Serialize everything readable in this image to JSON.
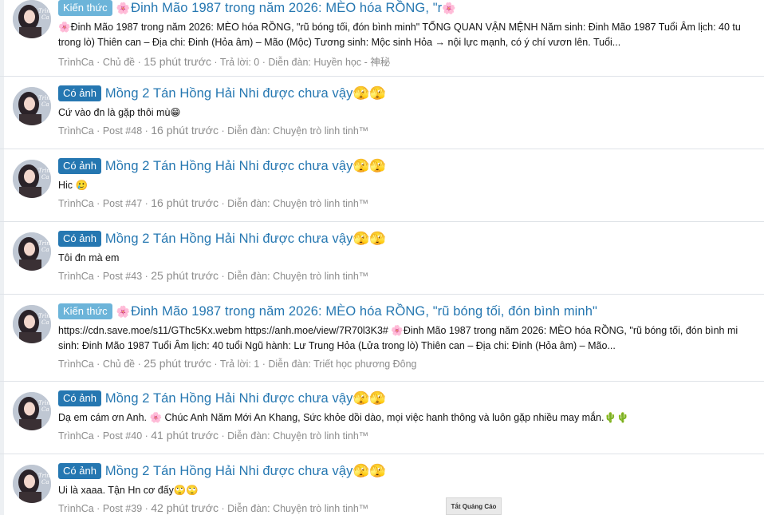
{
  "items": [
    {
      "badge": "Kiến thức",
      "badge_color": "#6cb4d9",
      "flower": "🌸",
      "title": "Đinh Mão 1987 trong năm 2026: MÈO hóa RỒNG, \"r",
      "title_suffix": "🌸",
      "snippet1": "🌸Đinh Mão 1987 trong năm 2026: MÈO hóa RỒNG, \"rũ bóng tối, đón bình minh\" TỔNG QUAN VẬN MỆNH Năm sinh: Đinh Mão 1987 Tuổi Âm lịch: 40 tu",
      "snippet2": "trong lò) Thiên can – Địa chi: Đinh (Hỏa âm) – Mão (Mộc) Tương sinh: Mộc sinh Hỏa → nội lực mạnh, có ý chí vươn lên. Tuổi...",
      "author": "TrìnhCa",
      "type": "Chủ đề",
      "time": "15 phút trước",
      "extra": "Trả lời: 0",
      "forum": "Diễn đàn: Huyền học - 神秘"
    },
    {
      "badge": "Có ảnh",
      "badge_color": "#2577b1",
      "title": "Mồng 2 Tán Hồng Hải Nhi được chưa vậy🫣🫣",
      "snippet1": "Cứ vào đn là gặp thôi mù😁",
      "author": "TrìnhCa",
      "type": "Post #48",
      "time": "16 phút trước",
      "forum": "Diễn đàn: Chuyện trò linh tinh™"
    },
    {
      "badge": "Có ảnh",
      "badge_color": "#2577b1",
      "title": "Mồng 2 Tán Hồng Hải Nhi được chưa vậy🫣🫣",
      "snippet1": "Hic 🥲",
      "author": "TrìnhCa",
      "type": "Post #47",
      "time": "16 phút trước",
      "forum": "Diễn đàn: Chuyện trò linh tinh™"
    },
    {
      "badge": "Có ảnh",
      "badge_color": "#2577b1",
      "title": "Mồng 2 Tán Hồng Hải Nhi được chưa vậy🫣🫣",
      "snippet1": "Tôi đn mà em",
      "author": "TrìnhCa",
      "type": "Post #43",
      "time": "25 phút trước",
      "forum": "Diễn đàn: Chuyện trò linh tinh™"
    },
    {
      "badge": "Kiến thức",
      "badge_color": "#6cb4d9",
      "flower": "🌸",
      "title": "Đinh Mão 1987 trong năm 2026: MÈO hóa RỒNG, \"rũ bóng tối, đón bình minh\"",
      "snippet1": "https://cdn.save.moe/s11/GThc5Kx.webm https://anh.moe/view/7R70l3K3# 🌸Đinh Mão 1987 trong năm 2026: MÈO hóa RỒNG, \"rũ bóng tối, đón bình mi",
      "snippet2": "sinh: Đinh Mão 1987 Tuổi Âm lịch: 40 tuổi Ngũ hành: Lư Trung Hỏa (Lửa trong lò) Thiên can – Địa chi: Đinh (Hỏa âm) – Mão...",
      "author": "TrìnhCa",
      "type": "Chủ đề",
      "time": "25 phút trước",
      "extra": "Trả lời: 1",
      "forum": "Diễn đàn: Triết học phương Đông"
    },
    {
      "badge": "Có ảnh",
      "badge_color": "#2577b1",
      "title": "Mồng 2 Tán Hồng Hải Nhi được chưa vậy🫣🫣",
      "snippet1": "Dạ em cám ơn Anh. 🌸 Chúc Anh Năm Mới An Khang, Sức khỏe dồi dào, mọi việc hanh thông và luôn gặp nhiều may mắn.🌵🌵",
      "author": "TrìnhCa",
      "type": "Post #40",
      "time": "41 phút trước",
      "forum": "Diễn đàn: Chuyện trò linh tinh™"
    },
    {
      "badge": "Có ảnh",
      "badge_color": "#2577b1",
      "title": "Mồng 2 Tán Hồng Hải Nhi được chưa vậy🫣🫣",
      "snippet1": "Ui là xaaa. Tận Hn cơ đấy🙄🙄",
      "author": "TrìnhCa",
      "type": "Post #39",
      "time": "42 phút trước",
      "forum": "Diễn đàn: Chuyện trò linh tinh™"
    }
  ],
  "ad_close_label": "Tắt Quảng Cáo"
}
